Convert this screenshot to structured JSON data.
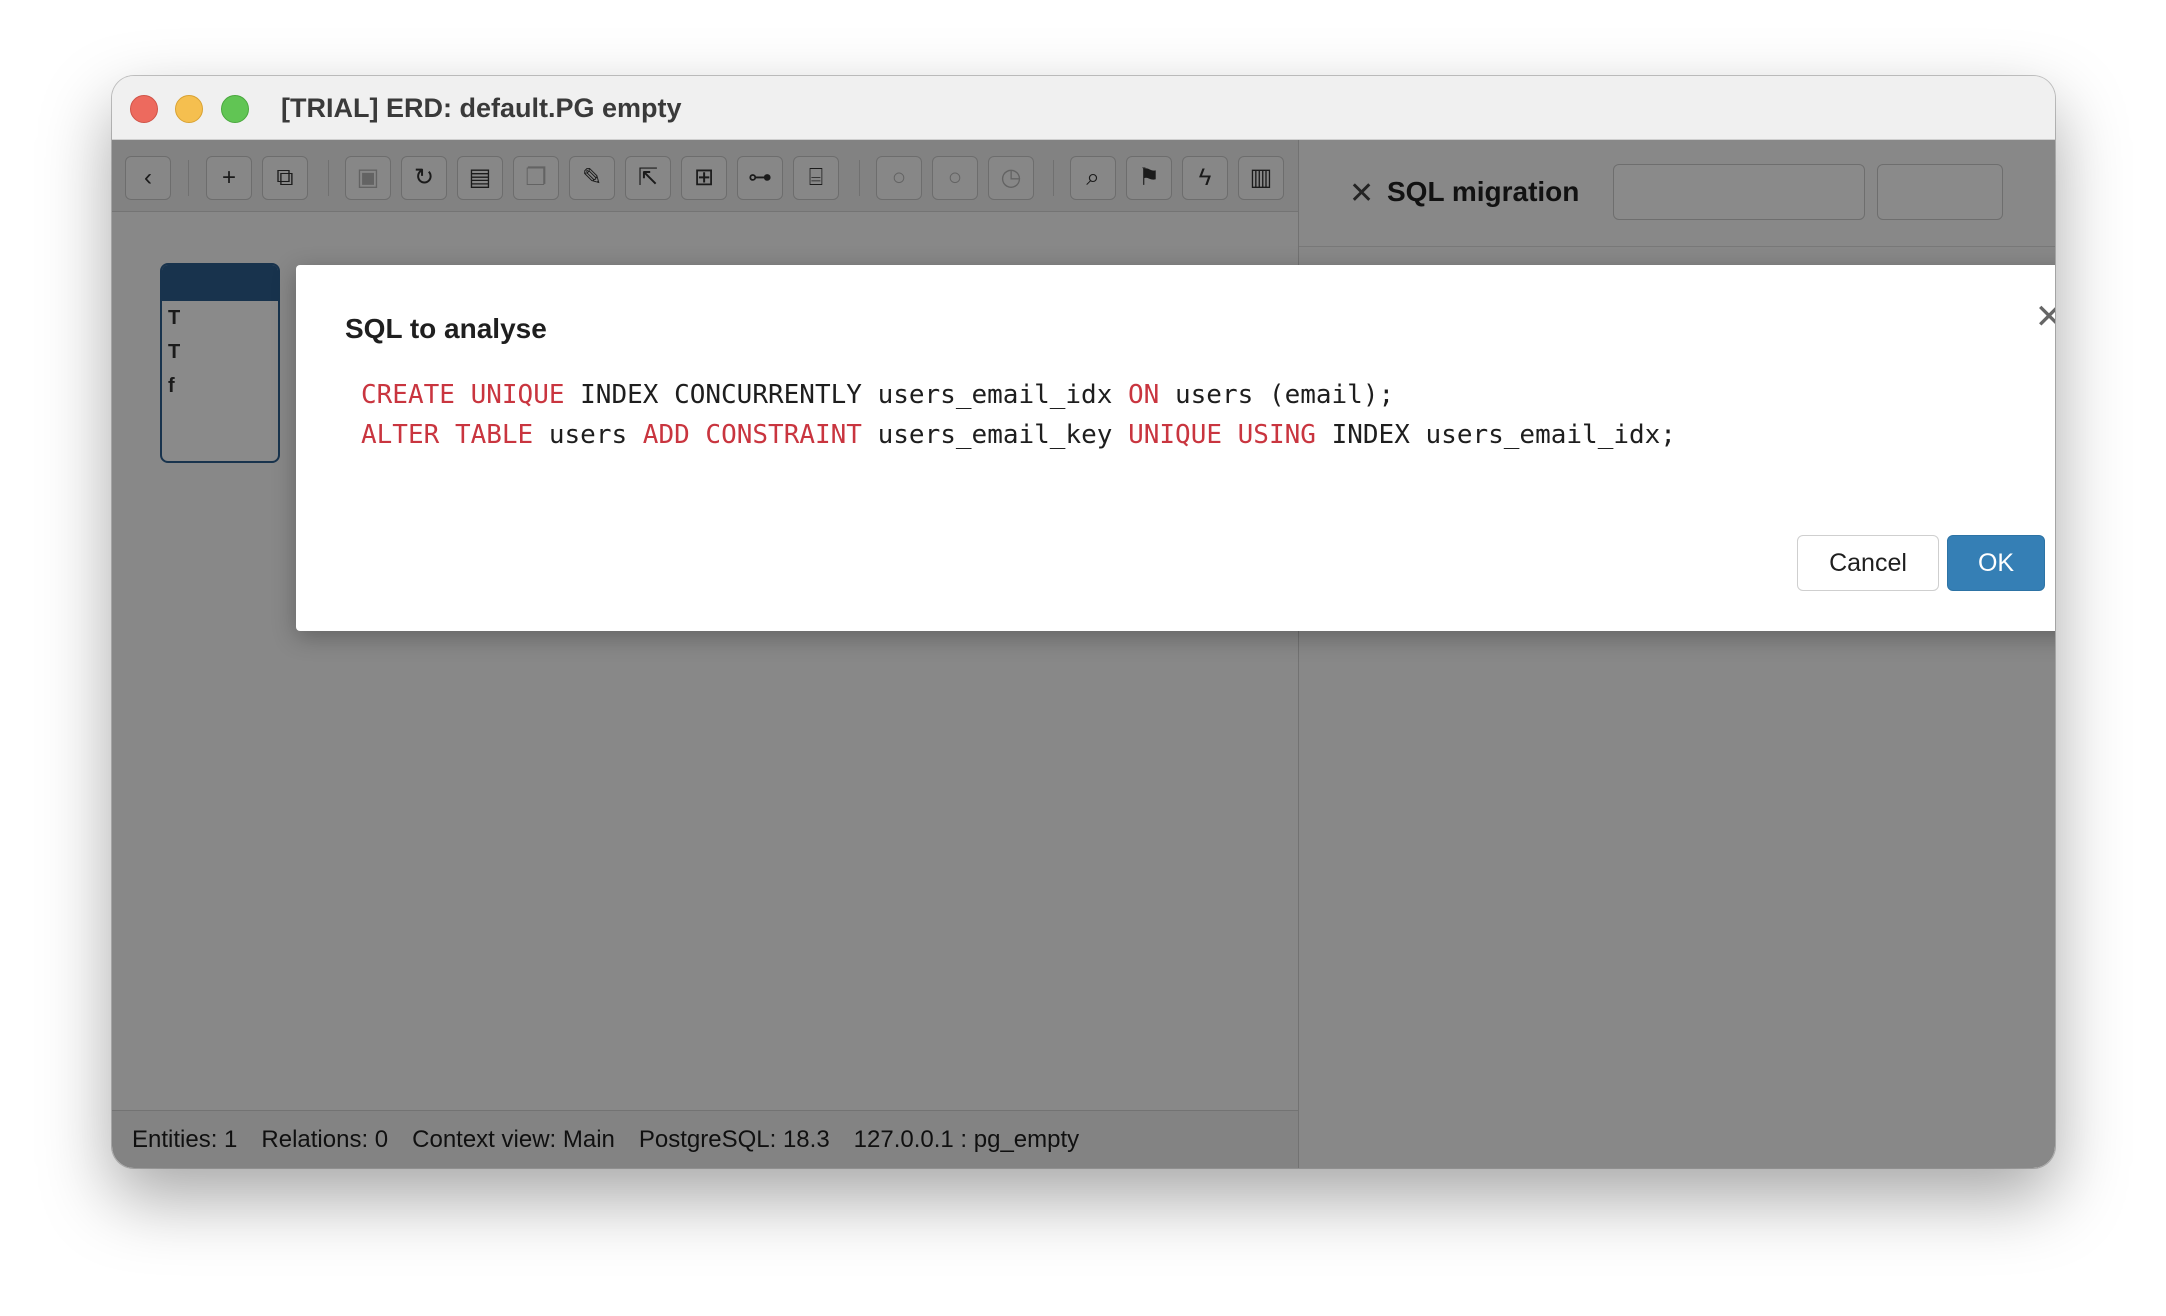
{
  "window": {
    "title": "[TRIAL] ERD: default.PG empty"
  },
  "toolbar": {
    "buttons": [
      {
        "icon": "back-icon",
        "glyph": "‹"
      },
      {
        "icon": "add-icon",
        "glyph": "+"
      },
      {
        "icon": "duplicate-icon",
        "glyph": "⧉"
      },
      {
        "icon": "save-icon",
        "glyph": "▣"
      },
      {
        "icon": "refresh-icon",
        "glyph": "↻"
      },
      {
        "icon": "layout-icon",
        "glyph": "▤"
      },
      {
        "icon": "copy-icon",
        "glyph": "❐"
      },
      {
        "icon": "edit-icon",
        "glyph": "✎"
      },
      {
        "icon": "export-icon",
        "glyph": "⇱"
      },
      {
        "icon": "grid-icon",
        "glyph": "⊞"
      },
      {
        "icon": "hierarchy-icon",
        "glyph": "⊶"
      },
      {
        "icon": "folder-open-icon",
        "glyph": "⌸"
      },
      {
        "icon": "circle-icon",
        "glyph": "○"
      },
      {
        "icon": "circle-icon",
        "glyph": "○"
      },
      {
        "icon": "clock-icon",
        "glyph": "◷"
      },
      {
        "icon": "search-icon",
        "glyph": "⌕"
      },
      {
        "icon": "flag-icon",
        "glyph": "⚑"
      },
      {
        "icon": "lightning-icon",
        "glyph": "ϟ"
      },
      {
        "icon": "report-icon",
        "glyph": "▥"
      }
    ]
  },
  "canvas": {
    "entity_rows": [
      "T",
      "T",
      "f"
    ]
  },
  "right_panel": {
    "title": "SQL migration"
  },
  "dialog": {
    "title": "SQL to analyse",
    "close_glyph": "✕",
    "sql_lines": [
      [
        {
          "t": "CREATE",
          "kw": true
        },
        {
          "t": " ",
          "kw": false
        },
        {
          "t": "UNIQUE",
          "kw": true
        },
        {
          "t": " INDEX CONCURRENTLY users_email_idx ",
          "kw": false
        },
        {
          "t": "ON",
          "kw": true
        },
        {
          "t": " users (email);",
          "kw": false
        }
      ],
      [
        {
          "t": "ALTER",
          "kw": true
        },
        {
          "t": " ",
          "kw": false
        },
        {
          "t": "TABLE",
          "kw": true
        },
        {
          "t": " users ",
          "kw": false
        },
        {
          "t": "ADD",
          "kw": true
        },
        {
          "t": " ",
          "kw": false
        },
        {
          "t": "CONSTRAINT",
          "kw": true
        },
        {
          "t": " users_email_key ",
          "kw": false
        },
        {
          "t": "UNIQUE",
          "kw": true
        },
        {
          "t": " ",
          "kw": false
        },
        {
          "t": "USING",
          "kw": true
        },
        {
          "t": " INDEX users_email_idx;",
          "kw": false
        }
      ]
    ],
    "cancel_label": "Cancel",
    "ok_label": "OK"
  },
  "statusbar": {
    "entities": "Entities: 1",
    "relations": "Relations: 0",
    "context_view": "Context view: Main",
    "db_version": "PostgreSQL: 18.3",
    "connection": "127.0.0.1 : pg_empty"
  },
  "colors": {
    "keyword": "#c9353f",
    "ok_button": "#357fb5",
    "entity_header": "#2e5e8e"
  }
}
